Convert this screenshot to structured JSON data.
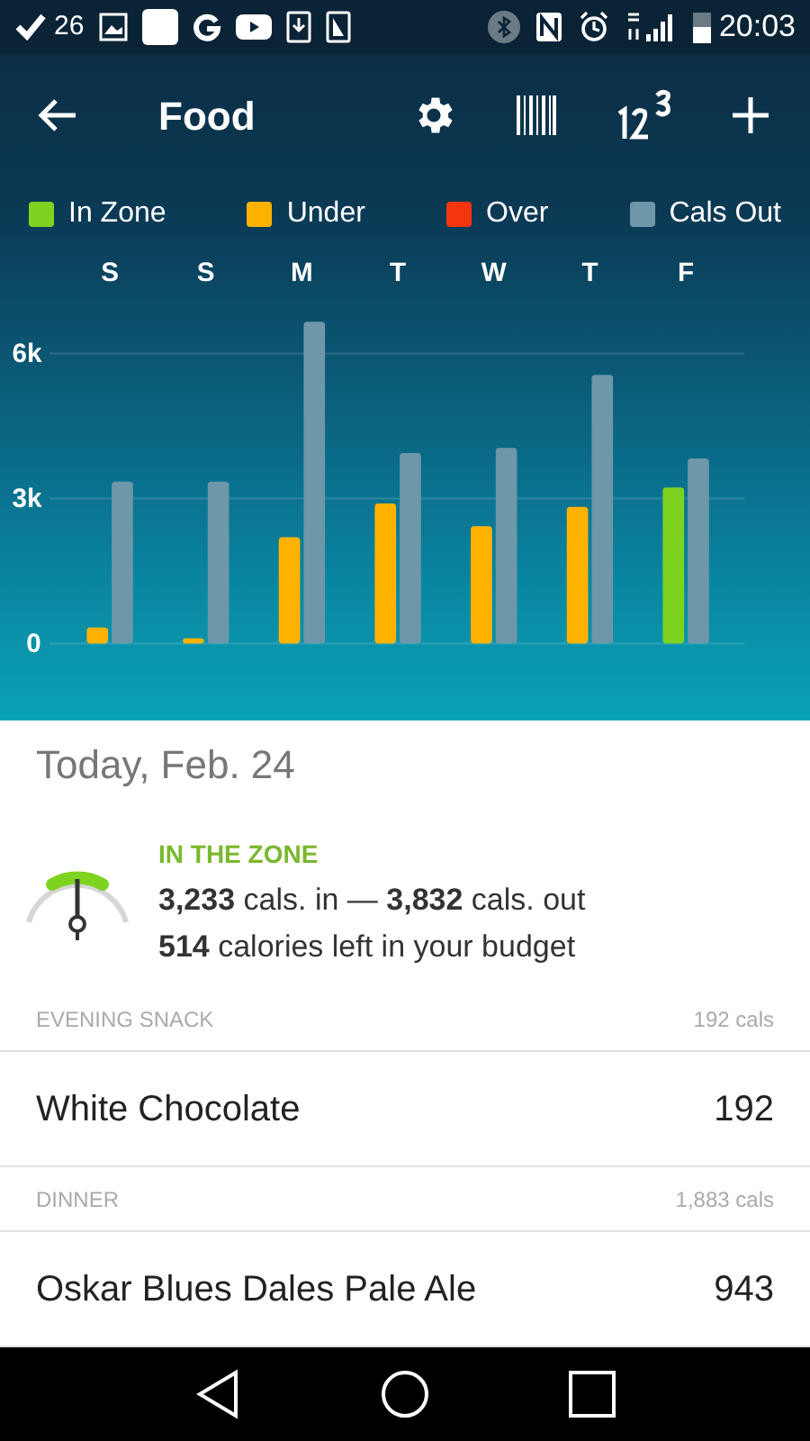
{
  "status_bar": {
    "notification_count": "26",
    "time": "20:03"
  },
  "toolbar": {
    "title": "Food"
  },
  "chart_data": {
    "type": "bar",
    "categories": [
      "S",
      "S",
      "M",
      "T",
      "W",
      "T",
      "F"
    ],
    "yticks": [
      {
        "value": 0,
        "label": "0"
      },
      {
        "value": 3000,
        "label": "3k"
      },
      {
        "value": 6000,
        "label": "6k"
      }
    ],
    "ylim": [
      0,
      6700
    ],
    "series": [
      {
        "name": "In Zone",
        "color": "#7ed321",
        "values": [
          null,
          null,
          null,
          null,
          null,
          null,
          3230
        ]
      },
      {
        "name": "Under",
        "color": "#ffb300",
        "values": [
          330,
          110,
          2200,
          2900,
          2430,
          2830,
          null
        ]
      },
      {
        "name": "Over",
        "color": "#f4350f",
        "values": [
          null,
          null,
          null,
          null,
          null,
          null,
          null
        ]
      },
      {
        "name": "Cals Out",
        "color": "#6e97aa",
        "values": [
          3350,
          3350,
          6660,
          3940,
          4050,
          5560,
          3830
        ]
      }
    ]
  },
  "day_title": "Today, Feb. 24",
  "summary": {
    "status": "IN THE ZONE",
    "line_1": "**3,233** cals. in — **3,832** cals. out",
    "line_2": "**514** calories left in your budget"
  },
  "meals": [
    {
      "name": "EVENING SNACK",
      "total": "192 cals",
      "items": [
        {
          "name": "White Chocolate",
          "calories": "192"
        }
      ]
    },
    {
      "name": "DINNER",
      "total": "1,883 cals",
      "items": [
        {
          "name": "Oskar Blues Dales Pale Ale",
          "calories": "943"
        }
      ]
    }
  ]
}
